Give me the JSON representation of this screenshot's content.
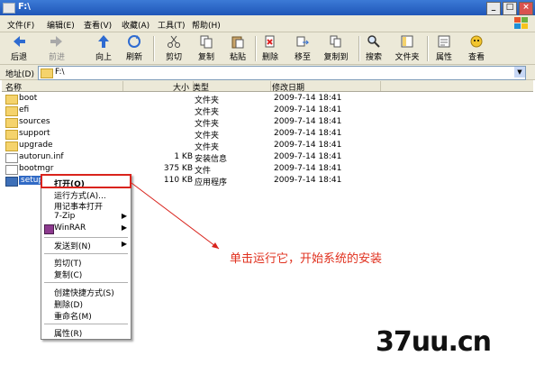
{
  "window": {
    "title": "F:\\"
  },
  "menu": [
    "文件(F)",
    "编辑(E)",
    "查看(V)",
    "收藏(A)",
    "工具(T)",
    "帮助(H)"
  ],
  "toolbar": {
    "back": "后退",
    "forward": "前进",
    "up": "向上",
    "refresh": "刷新",
    "cut": "剪切",
    "copy": "复制",
    "paste": "粘贴",
    "delete": "删除",
    "move_to": "移至",
    "copy_to": "复制到",
    "search": "搜索",
    "folders": "文件夹",
    "properties": "属性",
    "view": "查看"
  },
  "address": {
    "label": "地址(D)",
    "value": "F:\\"
  },
  "columns": {
    "name": "名称",
    "size": "大小",
    "type": "类型",
    "modified": "修改日期"
  },
  "files": [
    {
      "name": "boot",
      "size": "",
      "type": "文件夹",
      "date": "2009-7-14 18:41",
      "icon": "folder"
    },
    {
      "name": "efi",
      "size": "",
      "type": "文件夹",
      "date": "2009-7-14 18:41",
      "icon": "folder"
    },
    {
      "name": "sources",
      "size": "",
      "type": "文件夹",
      "date": "2009-7-14 18:41",
      "icon": "folder"
    },
    {
      "name": "support",
      "size": "",
      "type": "文件夹",
      "date": "2009-7-14 18:41",
      "icon": "folder"
    },
    {
      "name": "upgrade",
      "size": "",
      "type": "文件夹",
      "date": "2009-7-14 18:41",
      "icon": "folder"
    },
    {
      "name": "autorun.inf",
      "size": "1 KB",
      "type": "安装信息",
      "date": "2009-7-14 18:41",
      "icon": "file"
    },
    {
      "name": "bootmgr",
      "size": "375 KB",
      "type": "文件",
      "date": "2009-7-14 18:41",
      "icon": "file"
    },
    {
      "name": "setup.exe",
      "size": "110 KB",
      "type": "应用程序",
      "date": "2009-7-14 18:41",
      "icon": "app"
    }
  ],
  "context_menu": [
    "打开(O)",
    "运行方式(A)...",
    "用记事本打开",
    "7-Zip",
    "WinRAR",
    "发送到(N)",
    "剪切(T)",
    "复制(C)",
    "创建快捷方式(S)",
    "删除(D)",
    "重命名(M)",
    "属性(R)"
  ],
  "annotation": "单击运行它，开始系统的安装",
  "watermark": "37uu.cn",
  "colors": {
    "titlebar": "#2a63c4",
    "highlight_box": "#d9231c",
    "annotation": "#e0301e"
  }
}
